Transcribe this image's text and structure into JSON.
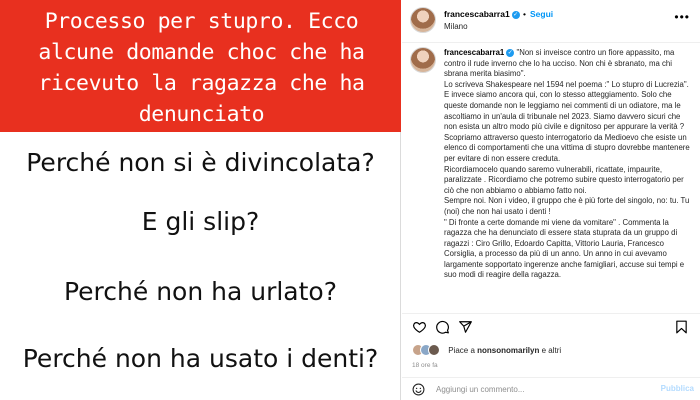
{
  "post_image": {
    "banner_text": "Processo per stupro. Ecco alcune domande choc che ha ricevuto la ragazza che ha denunciato",
    "banner_color": "#e8301f",
    "questions": [
      "Perché non si è divincolata?",
      "E gli slip?",
      "Perché non ha urlato?",
      "Perché non ha usato i denti?"
    ]
  },
  "header": {
    "username": "francescabarra1",
    "separator": "•",
    "follow_label": "Segui",
    "location": "Milano",
    "more_icon": "more-options-icon"
  },
  "caption": {
    "username": "francescabarra1",
    "paragraphs": [
      "\"Non si inveisce contro un fiore appassito, ma contro il rude inverno che lo ha ucciso. Non chi è sbranato, ma chi sbrana merita biasimo\".",
      "Lo scriveva Shakespeare nel 1594 nel poema :\" Lo stupro di Lucrezia\".",
      "E invece siamo ancora qui, con lo stesso atteggiamento. Solo che queste domande non le leggiamo nei commenti di un odiatore, ma le ascoltiamo in un'aula di tribunale nel 2023. Siamo davvero sicuri che non esista un altro modo più civile e dignitoso per appurare la verità ?",
      "Scopriamo attraverso questo interrogatorio da Medioevo che esiste un elenco di comportamenti che una vittima di stupro dovrebbe mantenere per evitare di non essere creduta.",
      "Ricordiamocelo quando saremo vulnerabili, ricattate, impaurite, paralizzate . Ricordiamo che potremo subire questo interrogatorio per ciò che non abbiamo o abbiamo fatto noi.",
      "Sempre noi. Non i video, il gruppo che è più forte del singolo, no: tu. Tu (noi) che non hai usato i denti !",
      "\" Di fronte a certe domande mi viene da vomitare\" . Commenta la ragazza che ha denunciato di essere stata stuprata da un gruppo di ragazzi : Ciro Grillo, Edoardo Capitta, Vittorio Lauria, Francesco Corsiglia, a processo da più di un anno. Un anno in cui avevamo largamente sopportato ingerenze anche famigliari, accuse sui tempi e suo modi di reagire della ragazza."
    ]
  },
  "actions": {
    "like_icon": "heart-icon",
    "comment_icon": "comment-icon",
    "share_icon": "share-icon",
    "save_icon": "bookmark-icon"
  },
  "likes": {
    "prefix": "Piace a ",
    "user": "nonsonomarilyn",
    "suffix": " e altri"
  },
  "time": "18 ore fa",
  "comment_box": {
    "emoji_icon": "emoji-icon",
    "placeholder": "Aggiungi un commento...",
    "publish_label": "Pubblica"
  }
}
